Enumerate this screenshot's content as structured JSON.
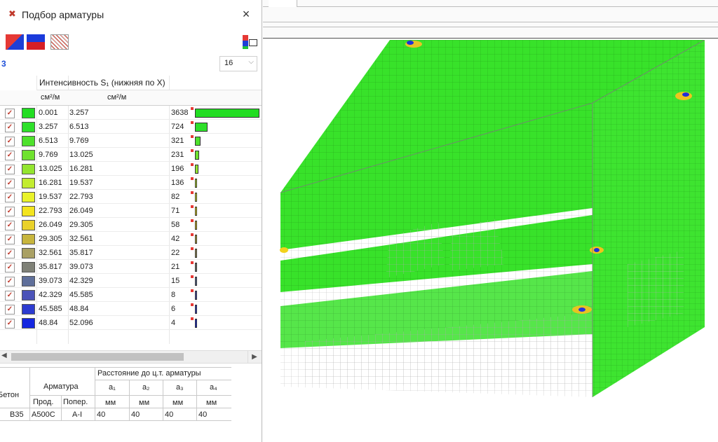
{
  "dialog": {
    "title": "Подбор арматуры",
    "close_label": "×",
    "combo_value": "16",
    "blue_mark": "3"
  },
  "table": {
    "header": "Интенсивность S₁ (нижняя по X)",
    "unit1": "см²/м",
    "unit2": "см²/м",
    "rows": [
      {
        "from": "0.001",
        "to": "3.257",
        "count": "3638",
        "color": "#21dd21",
        "fraction": 1.0
      },
      {
        "from": "3.257",
        "to": "6.513",
        "count": "724",
        "color": "#2ee02a",
        "fraction": 0.2
      },
      {
        "from": "6.513",
        "to": "9.769",
        "count": "321",
        "color": "#4ee12c",
        "fraction": 0.088
      },
      {
        "from": "9.769",
        "to": "13.025",
        "count": "231",
        "color": "#6fe22e",
        "fraction": 0.064
      },
      {
        "from": "13.025",
        "to": "16.281",
        "count": "196",
        "color": "#93e52f",
        "fraction": 0.054
      },
      {
        "from": "16.281",
        "to": "19.537",
        "count": "136",
        "color": "#c2ec30",
        "fraction": 0.037
      },
      {
        "from": "19.537",
        "to": "22.793",
        "count": "82",
        "color": "#e9f22a",
        "fraction": 0.023
      },
      {
        "from": "22.793",
        "to": "26.049",
        "count": "71",
        "color": "#f3e41e",
        "fraction": 0.02
      },
      {
        "from": "26.049",
        "to": "29.305",
        "count": "58",
        "color": "#e9d12a",
        "fraction": 0.016
      },
      {
        "from": "29.305",
        "to": "32.561",
        "count": "42",
        "color": "#c7b53d",
        "fraction": 0.012
      },
      {
        "from": "32.561",
        "to": "35.817",
        "count": "22",
        "color": "#a9a064",
        "fraction": 0.006
      },
      {
        "from": "35.817",
        "to": "39.073",
        "count": "21",
        "color": "#7f8177",
        "fraction": 0.006
      },
      {
        "from": "39.073",
        "to": "42.329",
        "count": "15",
        "color": "#5f6f9a",
        "fraction": 0.004
      },
      {
        "from": "42.329",
        "to": "45.585",
        "count": "8",
        "color": "#4a52b8",
        "fraction": 0.002
      },
      {
        "from": "45.585",
        "to": "48.84",
        "count": "6",
        "color": "#2c3bd0",
        "fraction": 0.002
      },
      {
        "from": "48.84",
        "to": "52.096",
        "count": "4",
        "color": "#1426e0",
        "fraction": 0.001
      }
    ]
  },
  "params": {
    "beton_header": "Бетон",
    "armatura_header": "Арматура",
    "dist_header": "Расстояние до ц.т. арматуры",
    "a1": "a₁",
    "a2": "a₂",
    "a3": "a₃",
    "a4": "a₄",
    "prod": "Прод.",
    "poper": "Попер.",
    "mm": "мм",
    "beton": "В35",
    "prod_val": "А500С",
    "poper_val": "А-I",
    "a1_val": "40",
    "a2_val": "40",
    "a3_val": "40",
    "a4_val": "40"
  },
  "colors": {
    "mesh_green": "#38e22a",
    "mesh_gray": "#e4e4e4"
  }
}
